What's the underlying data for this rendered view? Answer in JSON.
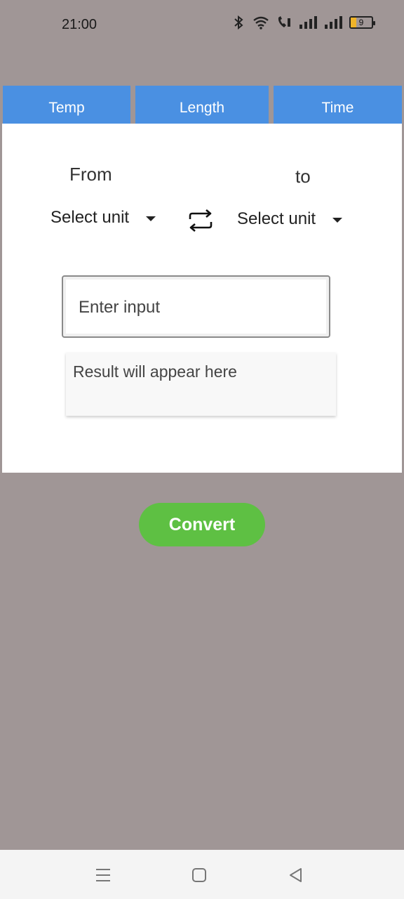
{
  "status_bar": {
    "time": "21:00",
    "battery_level": "9",
    "icons": [
      "bluetooth-icon",
      "wifi-icon",
      "call-icon",
      "signal-icon",
      "signal-icon",
      "battery-icon"
    ]
  },
  "tabs": [
    {
      "label": "Temp"
    },
    {
      "label": "Length"
    },
    {
      "label": "Time"
    }
  ],
  "converter": {
    "from_label": "From",
    "to_label": "to",
    "from_select": "Select unit",
    "to_select": "Select unit",
    "swap_icon": "swap-icon",
    "input_placeholder": "Enter input",
    "input_value": "",
    "result_placeholder": "Result will appear here",
    "convert_label": "Convert"
  },
  "colors": {
    "background": "#a09696",
    "tab": "#4a90e2",
    "convert": "#5ec043"
  },
  "nav_bar": {
    "icons": [
      "menu-icon",
      "home-icon",
      "back-icon"
    ]
  }
}
